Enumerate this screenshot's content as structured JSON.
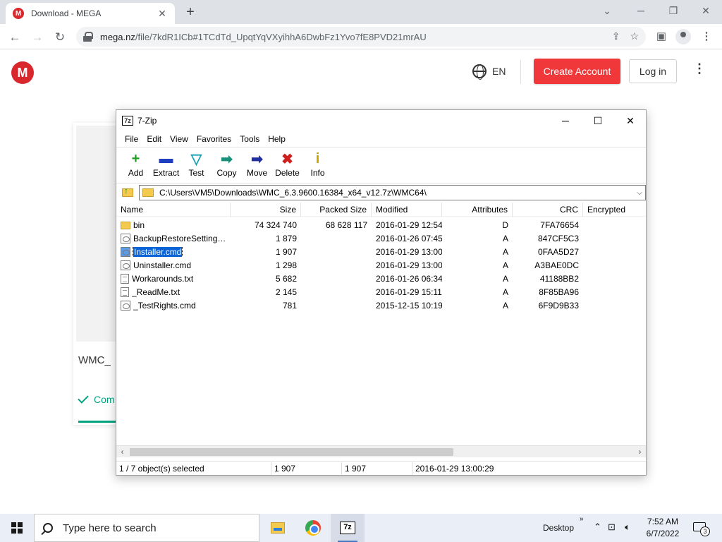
{
  "browser": {
    "tab_title": "Download - MEGA",
    "tab_favicon": "M",
    "tab_close": "✕",
    "new_tab": "+",
    "url_host": "mega.nz",
    "url_path": "/file/7kdR1ICb#1TCdTd_UpqtYqVXyihhA6DwbFz1Yvo7fE8PVD21mrAU"
  },
  "mega": {
    "logo": "M",
    "language": "EN",
    "create_account": "Create Account",
    "login": "Log in",
    "file_name_partial": "WMC_",
    "status_partial": "Com",
    "accent": "#f0373a",
    "success": "#00a382"
  },
  "zip": {
    "title": "7-Zip",
    "icon_text": "7z",
    "menu": [
      "File",
      "Edit",
      "View",
      "Favorites",
      "Tools",
      "Help"
    ],
    "tools": [
      {
        "label": "Add",
        "glyph": "+",
        "color": "#1e9e1e",
        "icon": "add-icon"
      },
      {
        "label": "Extract",
        "glyph": "▬",
        "color": "#1f3fbf",
        "icon": "extract-icon"
      },
      {
        "label": "Test",
        "glyph": "▽",
        "color": "#1aa0b0",
        "icon": "test-icon"
      },
      {
        "label": "Copy",
        "glyph": "➡",
        "color": "#1a8f7a",
        "icon": "copy-icon"
      },
      {
        "label": "Move",
        "glyph": "➡",
        "color": "#1f2fa0",
        "icon": "move-icon"
      },
      {
        "label": "Delete",
        "glyph": "✖",
        "color": "#d01f1f",
        "icon": "delete-icon"
      },
      {
        "label": "Info",
        "glyph": "i",
        "color": "#c8a800",
        "icon": "info-icon"
      }
    ],
    "path": "C:\\Users\\VM5\\Downloads\\WMC_6.3.9600.16384_x64_v12.7z\\WMC64\\",
    "columns": {
      "name": "Name",
      "size": "Size",
      "packed": "Packed Size",
      "modified": "Modified",
      "attributes": "Attributes",
      "crc": "CRC",
      "encrypted": "Encrypted"
    },
    "files": [
      {
        "name": "bin",
        "type": "folder",
        "size": "74 324 740",
        "packed": "68 628 117",
        "modified": "2016-01-29 12:54",
        "attr": "D",
        "crc": "7FA76654",
        "selected": false
      },
      {
        "name": "BackupRestoreSettings....",
        "type": "cmd",
        "size": "1 879",
        "packed": "",
        "modified": "2016-01-26 07:45",
        "attr": "A",
        "crc": "847CF5C3",
        "selected": false
      },
      {
        "name": "Installer.cmd",
        "type": "cmd",
        "size": "1 907",
        "packed": "",
        "modified": "2016-01-29 13:00",
        "attr": "A",
        "crc": "0FAA5D27",
        "selected": true
      },
      {
        "name": "Uninstaller.cmd",
        "type": "cmd",
        "size": "1 298",
        "packed": "",
        "modified": "2016-01-29 13:00",
        "attr": "A",
        "crc": "A3BAE0DC",
        "selected": false
      },
      {
        "name": "Workarounds.txt",
        "type": "txt",
        "size": "5 682",
        "packed": "",
        "modified": "2016-01-26 06:34",
        "attr": "A",
        "crc": "41188BB2",
        "selected": false
      },
      {
        "name": "_ReadMe.txt",
        "type": "txt",
        "size": "2 145",
        "packed": "",
        "modified": "2016-01-29 15:11",
        "attr": "A",
        "crc": "8F85BA96",
        "selected": false
      },
      {
        "name": "_TestRights.cmd",
        "type": "cmd",
        "size": "781",
        "packed": "",
        "modified": "2015-12-15 10:19",
        "attr": "A",
        "crc": "6F9D9B33",
        "selected": false
      }
    ],
    "status": {
      "selection": "1 / 7 object(s) selected",
      "size": "1 907",
      "packed": "1 907",
      "modified": "2016-01-29 13:00:29"
    }
  },
  "taskbar": {
    "search_placeholder": "Type here to search",
    "desktop_label": "Desktop",
    "time": "7:52 AM",
    "date": "6/7/2022",
    "notification_count": "3"
  }
}
